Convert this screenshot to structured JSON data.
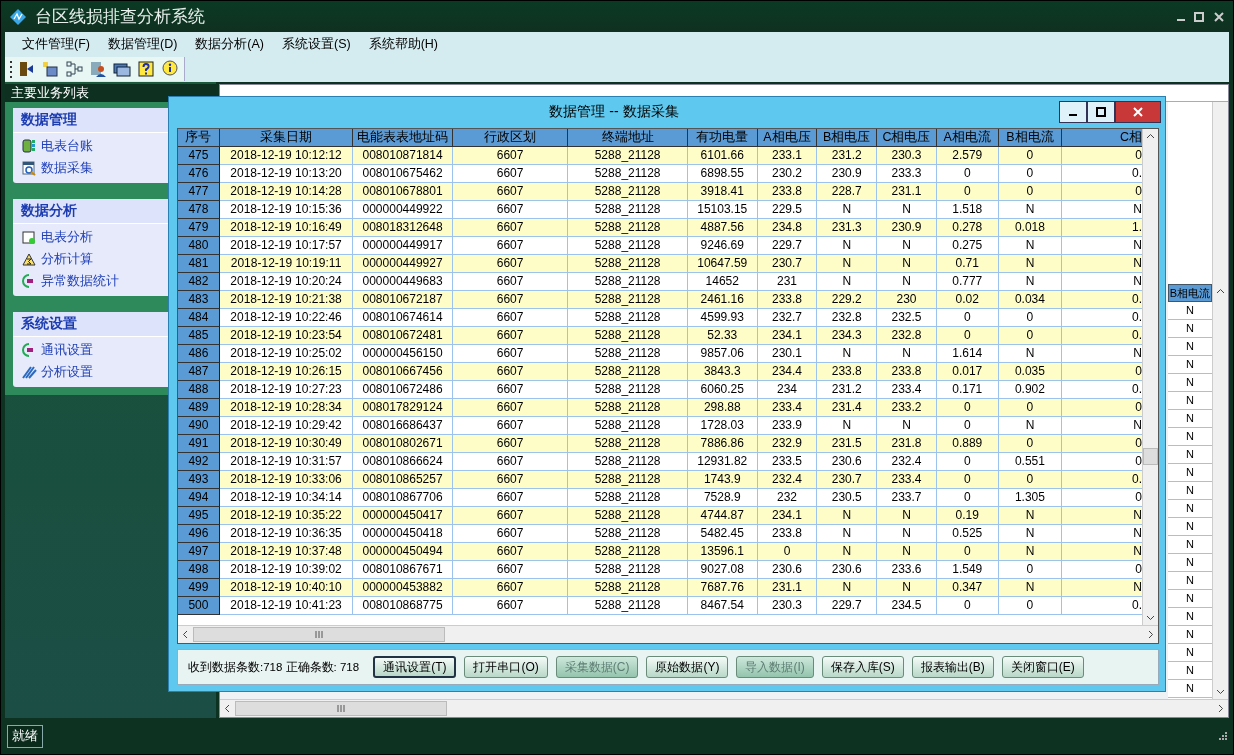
{
  "window": {
    "title": "台区线损排查分析系统"
  },
  "menu": [
    "文件管理(F)",
    "数据管理(D)",
    "数据分析(A)",
    "系统设置(S)",
    "系统帮助(H)"
  ],
  "sidebar": {
    "title": "主要业务列表",
    "groups": [
      {
        "title": "数据管理",
        "items": [
          "电表台账",
          "数据采集"
        ]
      },
      {
        "title": "数据分析",
        "items": [
          "电表分析",
          "分析计算",
          "异常数据统计"
        ]
      },
      {
        "title": "系统设置",
        "items": [
          "通讯设置",
          "分析设置"
        ]
      }
    ]
  },
  "background_table": {
    "column": "B相电流",
    "cells": [
      "N",
      "N",
      "N",
      "N",
      "N",
      "N",
      "N",
      "N",
      "N",
      "N",
      "N",
      "N",
      "N",
      "N",
      "N",
      "N",
      "N",
      "N",
      "N",
      "N",
      "N",
      "N"
    ]
  },
  "dialog": {
    "title": "数据管理 -- 数据采集",
    "table": {
      "columns": [
        "序号",
        "采集日期",
        "电能表表地址码",
        "行政区划",
        "终端地址",
        "有功电量",
        "A相电压",
        "B相电压",
        "C相电压",
        "A相电流",
        "B相电流",
        "C相"
      ],
      "rows": [
        [
          "475",
          "2018-12-19 10:12:12",
          "008010871814",
          "6607",
          "5288_21128",
          "6101.66",
          "233.1",
          "231.2",
          "230.3",
          "2.579",
          "0",
          "0"
        ],
        [
          "476",
          "2018-12-19 10:13:20",
          "008010675462",
          "6607",
          "5288_21128",
          "6898.55",
          "230.2",
          "230.9",
          "233.3",
          "0",
          "0",
          "0."
        ],
        [
          "477",
          "2018-12-19 10:14:28",
          "008010678801",
          "6607",
          "5288_21128",
          "3918.41",
          "233.8",
          "228.7",
          "231.1",
          "0",
          "0",
          "0"
        ],
        [
          "478",
          "2018-12-19 10:15:36",
          "000000449922",
          "6607",
          "5288_21128",
          "15103.15",
          "229.5",
          "N",
          "N",
          "1.518",
          "N",
          "N"
        ],
        [
          "479",
          "2018-12-19 10:16:49",
          "008018312648",
          "6607",
          "5288_21128",
          "4887.56",
          "234.8",
          "231.3",
          "230.9",
          "0.278",
          "0.018",
          "1."
        ],
        [
          "480",
          "2018-12-19 10:17:57",
          "000000449917",
          "6607",
          "5288_21128",
          "9246.69",
          "229.7",
          "N",
          "N",
          "0.275",
          "N",
          "N"
        ],
        [
          "481",
          "2018-12-19 10:19:11",
          "000000449927",
          "6607",
          "5288_21128",
          "10647.59",
          "230.7",
          "N",
          "N",
          "0.71",
          "N",
          "N"
        ],
        [
          "482",
          "2018-12-19 10:20:24",
          "000000449683",
          "6607",
          "5288_21128",
          "14652",
          "231",
          "N",
          "N",
          "0.777",
          "N",
          "N"
        ],
        [
          "483",
          "2018-12-19 10:21:38",
          "008010672187",
          "6607",
          "5288_21128",
          "2461.16",
          "233.8",
          "229.2",
          "230",
          "0.02",
          "0.034",
          "0."
        ],
        [
          "484",
          "2018-12-19 10:22:46",
          "008010674614",
          "6607",
          "5288_21128",
          "4599.93",
          "232.7",
          "232.8",
          "232.5",
          "0",
          "0",
          "0."
        ],
        [
          "485",
          "2018-12-19 10:23:54",
          "008010672481",
          "6607",
          "5288_21128",
          "52.33",
          "234.1",
          "234.3",
          "232.8",
          "0",
          "0",
          "0."
        ],
        [
          "486",
          "2018-12-19 10:25:02",
          "000000456150",
          "6607",
          "5288_21128",
          "9857.06",
          "230.1",
          "N",
          "N",
          "1.614",
          "N",
          "N"
        ],
        [
          "487",
          "2018-12-19 10:26:15",
          "008010667456",
          "6607",
          "5288_21128",
          "3843.3",
          "234.4",
          "233.8",
          "233.8",
          "0.017",
          "0.035",
          "0"
        ],
        [
          "488",
          "2018-12-19 10:27:23",
          "008010672486",
          "6607",
          "5288_21128",
          "6060.25",
          "234",
          "231.2",
          "233.4",
          "0.171",
          "0.902",
          "0."
        ],
        [
          "489",
          "2018-12-19 10:28:34",
          "008017829124",
          "6607",
          "5288_21128",
          "298.88",
          "233.4",
          "231.4",
          "233.2",
          "0",
          "0",
          "0"
        ],
        [
          "490",
          "2018-12-19 10:29:42",
          "008016686437",
          "6607",
          "5288_21128",
          "1728.03",
          "233.9",
          "N",
          "N",
          "0",
          "N",
          "N"
        ],
        [
          "491",
          "2018-12-19 10:30:49",
          "008010802671",
          "6607",
          "5288_21128",
          "7886.86",
          "232.9",
          "231.5",
          "231.8",
          "0.889",
          "0",
          "0"
        ],
        [
          "492",
          "2018-12-19 10:31:57",
          "008010866624",
          "6607",
          "5288_21128",
          "12931.82",
          "233.5",
          "230.6",
          "232.4",
          "0",
          "0.551",
          "0"
        ],
        [
          "493",
          "2018-12-19 10:33:06",
          "008010865257",
          "6607",
          "5288_21128",
          "1743.9",
          "232.4",
          "230.7",
          "233.4",
          "0",
          "0",
          "0."
        ],
        [
          "494",
          "2018-12-19 10:34:14",
          "008010867706",
          "6607",
          "5288_21128",
          "7528.9",
          "232",
          "230.5",
          "233.7",
          "0",
          "1.305",
          "0"
        ],
        [
          "495",
          "2018-12-19 10:35:22",
          "000000450417",
          "6607",
          "5288_21128",
          "4744.87",
          "234.1",
          "N",
          "N",
          "0.19",
          "N",
          "N"
        ],
        [
          "496",
          "2018-12-19 10:36:35",
          "000000450418",
          "6607",
          "5288_21128",
          "5482.45",
          "233.8",
          "N",
          "N",
          "0.525",
          "N",
          "N"
        ],
        [
          "497",
          "2018-12-19 10:37:48",
          "000000450494",
          "6607",
          "5288_21128",
          "13596.1",
          "0",
          "N",
          "N",
          "0",
          "N",
          "N"
        ],
        [
          "498",
          "2018-12-19 10:39:02",
          "008010867671",
          "6607",
          "5288_21128",
          "9027.08",
          "230.6",
          "230.6",
          "233.6",
          "1.549",
          "0",
          "0"
        ],
        [
          "499",
          "2018-12-19 10:40:10",
          "000000453882",
          "6607",
          "5288_21128",
          "7687.76",
          "231.1",
          "N",
          "N",
          "0.347",
          "N",
          "N"
        ],
        [
          "500",
          "2018-12-19 10:41:23",
          "008010868775",
          "6607",
          "5288_21128",
          "8467.54",
          "230.3",
          "229.7",
          "234.5",
          "0",
          "0",
          "0."
        ]
      ]
    },
    "summary": "收到数据条数:718 正确条数: 718",
    "buttons": [
      {
        "label": "通讯设置(T)",
        "disabled": false,
        "focused": true
      },
      {
        "label": "打开串口(O)",
        "disabled": false,
        "focused": false
      },
      {
        "label": "采集数据(C)",
        "disabled": true,
        "focused": false
      },
      {
        "label": "原始数据(Y)",
        "disabled": false,
        "focused": false
      },
      {
        "label": "导入数据(I)",
        "disabled": true,
        "focused": false
      },
      {
        "label": "保存入库(S)",
        "disabled": false,
        "focused": false
      },
      {
        "label": "报表输出(B)",
        "disabled": false,
        "focused": false
      },
      {
        "label": "关闭窗口(E)",
        "disabled": false,
        "focused": false
      }
    ]
  },
  "status_bar": "就绪"
}
